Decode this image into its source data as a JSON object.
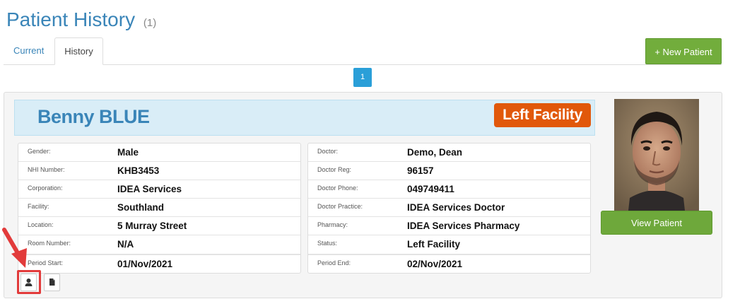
{
  "page": {
    "title": "Patient History",
    "count": "(1)"
  },
  "tabs": [
    {
      "label": "Current",
      "active": false
    },
    {
      "label": "History",
      "active": true
    }
  ],
  "actions": {
    "new_patient_label": "+ New Patient",
    "view_patient_label": "View Patient"
  },
  "pagination": {
    "current_page": "1"
  },
  "patient": {
    "name": "Benny BLUE",
    "status_badge": "Left Facility",
    "left_fields": [
      {
        "label": "Gender:",
        "value": "Male"
      },
      {
        "label": "NHI Number:",
        "value": "KHB3453"
      },
      {
        "label": "Corporation:",
        "value": "IDEA Services"
      },
      {
        "label": "Facility:",
        "value": "Southland"
      },
      {
        "label": "Location:",
        "value": "5 Murray Street"
      },
      {
        "label": "Room Number:",
        "value": "N/A"
      },
      {
        "label": "Period Start:",
        "value": "01/Nov/2021"
      }
    ],
    "right_fields": [
      {
        "label": "Doctor:",
        "value": "Demo, Dean"
      },
      {
        "label": "Doctor Reg:",
        "value": "96157"
      },
      {
        "label": "Doctor Phone:",
        "value": "049749411"
      },
      {
        "label": "Doctor Practice:",
        "value": "IDEA Services Doctor"
      },
      {
        "label": "Pharmacy:",
        "value": "IDEA Services Pharmacy"
      },
      {
        "label": "Status:",
        "value": "Left Facility"
      },
      {
        "label": "Period End:",
        "value": "02/Nov/2021"
      }
    ]
  },
  "icons": {
    "person_button": "person-icon",
    "document_button": "document-icon"
  },
  "colors": {
    "title_blue": "#3a85b8",
    "green_button": "#72ad3c",
    "status_orange": "#e1580b",
    "pager_blue": "#2a9fd8",
    "highlight_red": "#e23b3b"
  }
}
